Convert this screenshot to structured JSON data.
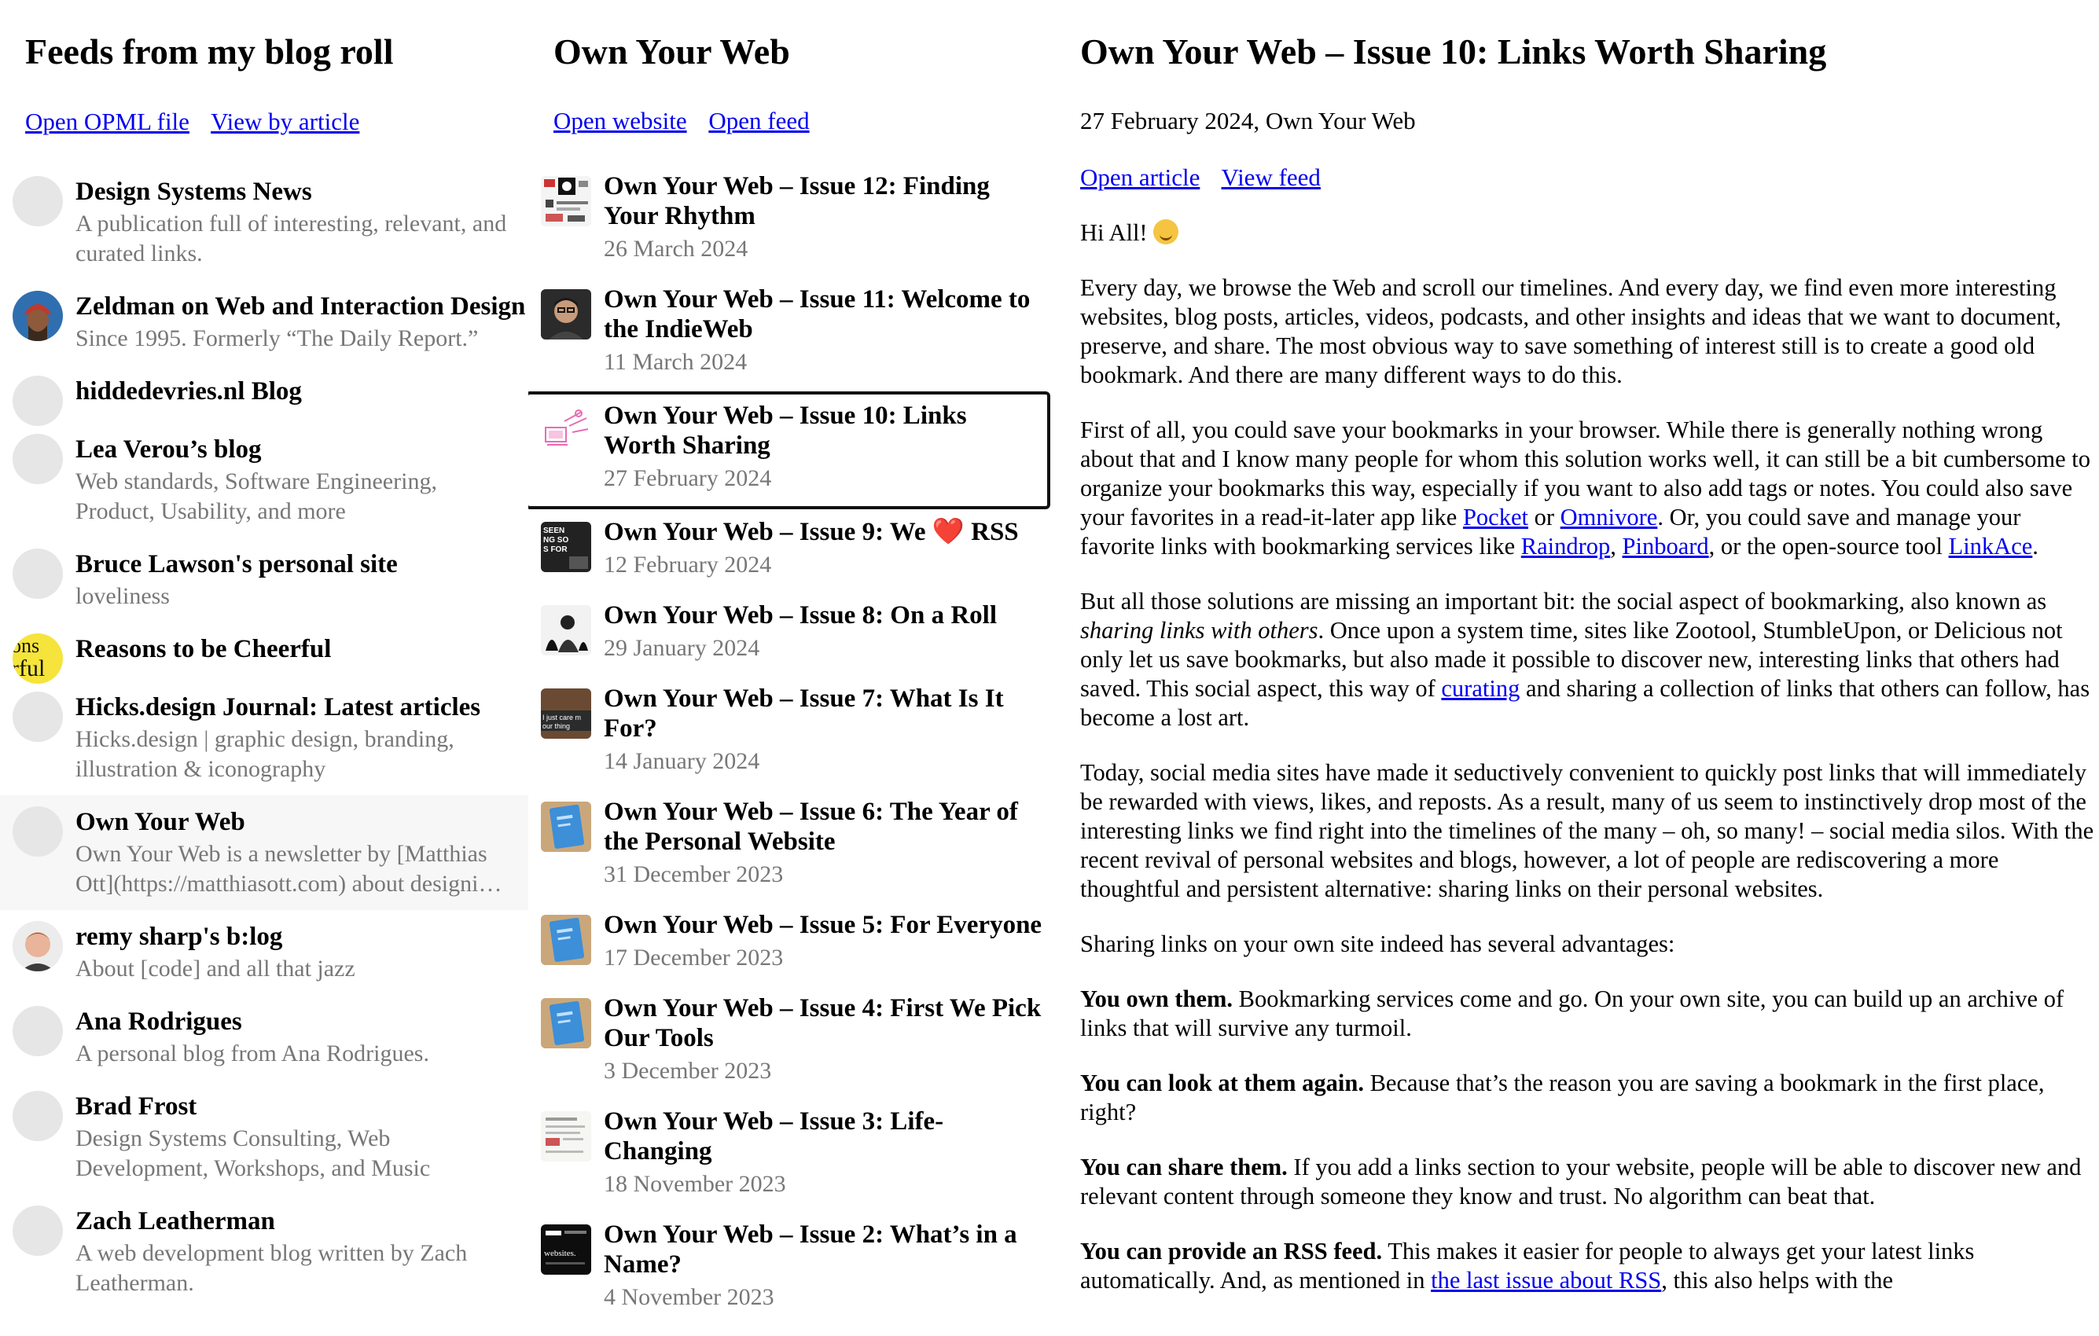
{
  "feeds_panel": {
    "title": "Feeds from my blog roll",
    "open_opml": "Open OPML file",
    "view_by_article": "View by article",
    "items": [
      {
        "title": "Design Systems News",
        "desc": "A publication full of interesting, relevant, and curated links.",
        "avatar": "placeholder"
      },
      {
        "title": "Zeldman on Web and Interaction Design",
        "desc": "Since 1995. Formerly “The Daily Report.”",
        "avatar": "person-beanie"
      },
      {
        "title": "hiddedevries.nl Blog",
        "desc": "",
        "avatar": "placeholder"
      },
      {
        "title": "Lea Verou’s blog",
        "desc": "Web standards, Software Engineering, Product, Usability, and more",
        "avatar": "placeholder"
      },
      {
        "title": "Bruce Lawson's personal site",
        "desc": "loveliness",
        "avatar": "placeholder"
      },
      {
        "title": "Reasons to be Cheerful",
        "desc": "",
        "avatar": "yellow-logo"
      },
      {
        "title": "Hicks.design Journal: Latest articles",
        "desc": "Hicks.design | graphic design, branding, illustration & iconography",
        "avatar": "placeholder"
      },
      {
        "title": "Own Your Web",
        "desc": "Own Your Web is a newsletter by [Matthias Ott](https://matthiasott.com) about designing and building websites and making your own home on the Web.",
        "avatar": "placeholder",
        "selected": true
      },
      {
        "title": "remy sharp's b:log",
        "desc": "About [code] and all that jazz",
        "avatar": "person-photo"
      },
      {
        "title": "Ana Rodrigues",
        "desc": "A personal blog from Ana Rodrigues.",
        "avatar": "placeholder"
      },
      {
        "title": "Brad Frost",
        "desc": "Design Systems Consulting, Web Development, Workshops, and Music",
        "avatar": "placeholder"
      },
      {
        "title": "Zach Leatherman",
        "desc": "A web development blog written by Zach Leatherman.",
        "avatar": "placeholder"
      }
    ]
  },
  "articles_panel": {
    "title": "Own Your Web",
    "open_website": "Open website",
    "open_feed": "Open feed",
    "items": [
      {
        "title": "Own Your Web – Issue 12: Finding Your Rhythm",
        "date": "26 March 2024",
        "thumb": "collage"
      },
      {
        "title": "Own Your Web – Issue 11: Welcome to the IndieWeb",
        "date": "11 March 2024",
        "thumb": "portrait"
      },
      {
        "title": "Own Your Web – Issue 10: Links Worth Sharing",
        "date": "27 February 2024",
        "thumb": "pink-sketch",
        "selected": true
      },
      {
        "title": "Own Your Web – Issue 9: We ❤️ RSS",
        "date": "12 February 2024",
        "thumb": "dark-poster"
      },
      {
        "title": "Own Your Web – Issue 8: On a Roll",
        "date": "29 January 2024",
        "thumb": "bw-figure"
      },
      {
        "title": "Own Your Web – Issue 7: What Is It For?",
        "date": "14 January 2024",
        "thumb": "brown-sign"
      },
      {
        "title": "Own Your Web – Issue 6: The Year of the Personal Website",
        "date": "31 December 2023",
        "thumb": "blue-book"
      },
      {
        "title": "Own Your Web – Issue 5: For Everyone",
        "date": "17 December 2023",
        "thumb": "blue-book"
      },
      {
        "title": "Own Your Web – Issue 4: First We Pick Our Tools",
        "date": "3 December 2023",
        "thumb": "blue-book"
      },
      {
        "title": "Own Your Web – Issue 3: Life-Changing",
        "date": "18 November 2023",
        "thumb": "doc-page"
      },
      {
        "title": "Own Your Web – Issue 2: What’s in a Name?",
        "date": "4 November 2023",
        "thumb": "dark-screen"
      }
    ]
  },
  "reader": {
    "title": "Own Your Web – Issue 10: Links Worth Sharing",
    "meta": "27 February 2024, Own Your Web",
    "open_article": "Open article",
    "view_feed": "View feed",
    "greeting": "Hi All!",
    "p1": "Every day, we browse the Web and scroll our timelines. And every day, we find even more interesting websites, blog posts, articles, videos, podcasts, and other insights and ideas that we want to document, preserve, and share. The most obvious way to save something of interest still is to create a good old bookmark. And there are many different ways to do this.",
    "p2_a": "First of all, you could save your bookmarks in your browser. While there is generally nothing wrong about that and I know many people for whom this solution works well, it can still be a bit cumbersome to organize your bookmarks this way, especially if you want to also add tags or notes. You could also save your favorites in a read-it-later app like ",
    "link_pocket": "Pocket",
    "p2_b": " or ",
    "link_omnivore": "Omnivore",
    "p2_c": ". Or, you could save and manage your favorite links with bookmarking services like ",
    "link_raindrop": "Raindrop",
    "p2_d": ", ",
    "link_pinboard": "Pinboard",
    "p2_e": ", or the open-source tool ",
    "link_linkace": "LinkAce",
    "p2_f": ".",
    "p3_a": "But all those solutions are missing an important bit: the social aspect of bookmarking, also known as ",
    "p3_em": "sharing links with others",
    "p3_b": ". Once upon a system time, sites like Zootool, StumbleUpon, or Delicious not only let us save bookmarks, but also made it possible to discover new, interesting links that others had saved. This social aspect, this way of ",
    "link_curating": "curating",
    "p3_c": " and sharing a collection of links that others can follow, has become a lost art.",
    "p4": "Today, social media sites have made it seductively convenient to quickly post links that will immediately be rewarded with views, likes, and reposts. As a result, many of us seem to instinctively drop most of the interesting links we find right into the timelines of the many – oh, so many! – social media silos. With the recent revival of personal websites and blogs, however, a lot of people are rediscovering a more thoughtful and persistent alternative: sharing links on their personal websites.",
    "p5": "Sharing links on your own site indeed has several advantages:",
    "p6_b": "You own them.",
    "p6": " Bookmarking services come and go. On your own site, you can build up an archive of links that will survive any turmoil.",
    "p7_b": "You can look at them again.",
    "p7": " Because that’s the reason you are saving a bookmark in the first place, right?",
    "p8_b": "You can share them.",
    "p8": " If you add a links section to your website, people will be able to discover new and relevant content through someone they know and trust. No algorithm can beat that.",
    "p9_b": "You can provide an RSS feed.",
    "p9_a": " This makes it easier for people to always get your latest links automatically. And, as mentioned in ",
    "link_rss": "the last issue about RSS",
    "p9_c": ", this also helps with the"
  }
}
